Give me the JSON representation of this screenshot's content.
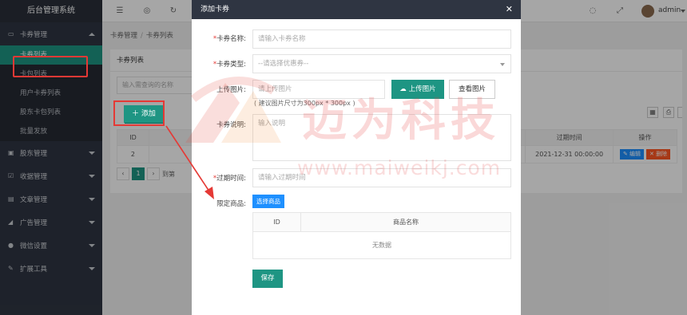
{
  "app": {
    "brand": "后台管理系统",
    "user": "admin"
  },
  "colors": {
    "sidebar": "#2f3542",
    "accent": "#1e9583",
    "blue": "#1e90ff",
    "danger": "#ff5722",
    "highlight": "#e53935"
  },
  "topbar": {
    "icons": [
      "menu-icon",
      "globe-icon",
      "refresh-icon",
      "theme-icon",
      "fullscreen-icon"
    ]
  },
  "sidebar": {
    "groups": [
      {
        "label": "卡券管理",
        "icon": "card-icon",
        "open": true,
        "items": [
          {
            "label": "卡券列表",
            "active": true
          },
          {
            "label": "卡包列表"
          },
          {
            "label": "用户卡券列表"
          },
          {
            "label": "股东卡包列表"
          },
          {
            "label": "批量发放"
          }
        ]
      },
      {
        "label": "股东管理",
        "icon": "shareholder-icon"
      },
      {
        "label": "收据管理",
        "icon": "receipt-icon"
      },
      {
        "label": "文章管理",
        "icon": "article-icon"
      },
      {
        "label": "广告管理",
        "icon": "ad-icon"
      },
      {
        "label": "微信设置",
        "icon": "wechat-icon"
      },
      {
        "label": "扩展工具",
        "icon": "tool-icon"
      }
    ]
  },
  "breadcrumb": {
    "parent": "卡券管理",
    "current": "卡券列表"
  },
  "card": {
    "title": "卡券列表",
    "search_placeholder": "输入需查询的名称",
    "add_label": "添加",
    "table": {
      "headers": {
        "id": "ID",
        "expire": "过期时间",
        "actions": "操作"
      },
      "rows": [
        {
          "id": "2",
          "expire": "2021-12-31 00:00:00",
          "edit": "编辑",
          "del": "删除"
        }
      ]
    },
    "pager": {
      "current": "1",
      "goto": "到第"
    }
  },
  "modal": {
    "title": "添加卡券",
    "fields": {
      "name": {
        "label": "卡券名称:",
        "placeholder": "请输入卡券名称"
      },
      "type": {
        "label": "卡券类型:",
        "placeholder": "--请选择优惠券--"
      },
      "image": {
        "label": "上传图片:",
        "placeholder": "请上传图片",
        "upload": "上传图片",
        "view": "查看图片",
        "hint": "( 建议图片尺寸为300px * 300px )"
      },
      "desc": {
        "label": "卡券说明:",
        "placeholder": "输入说明"
      },
      "expire": {
        "label": "过期时间:",
        "placeholder": "请输入过期时间"
      },
      "goods": {
        "label": "限定商品:",
        "button": "选择商品"
      }
    },
    "goods_table": {
      "headers": [
        "ID",
        "商品名称"
      ],
      "empty": "无数据"
    },
    "save": "保存"
  },
  "watermark": {
    "cn": "迈为科技",
    "url": "www.maiweikj.com"
  }
}
